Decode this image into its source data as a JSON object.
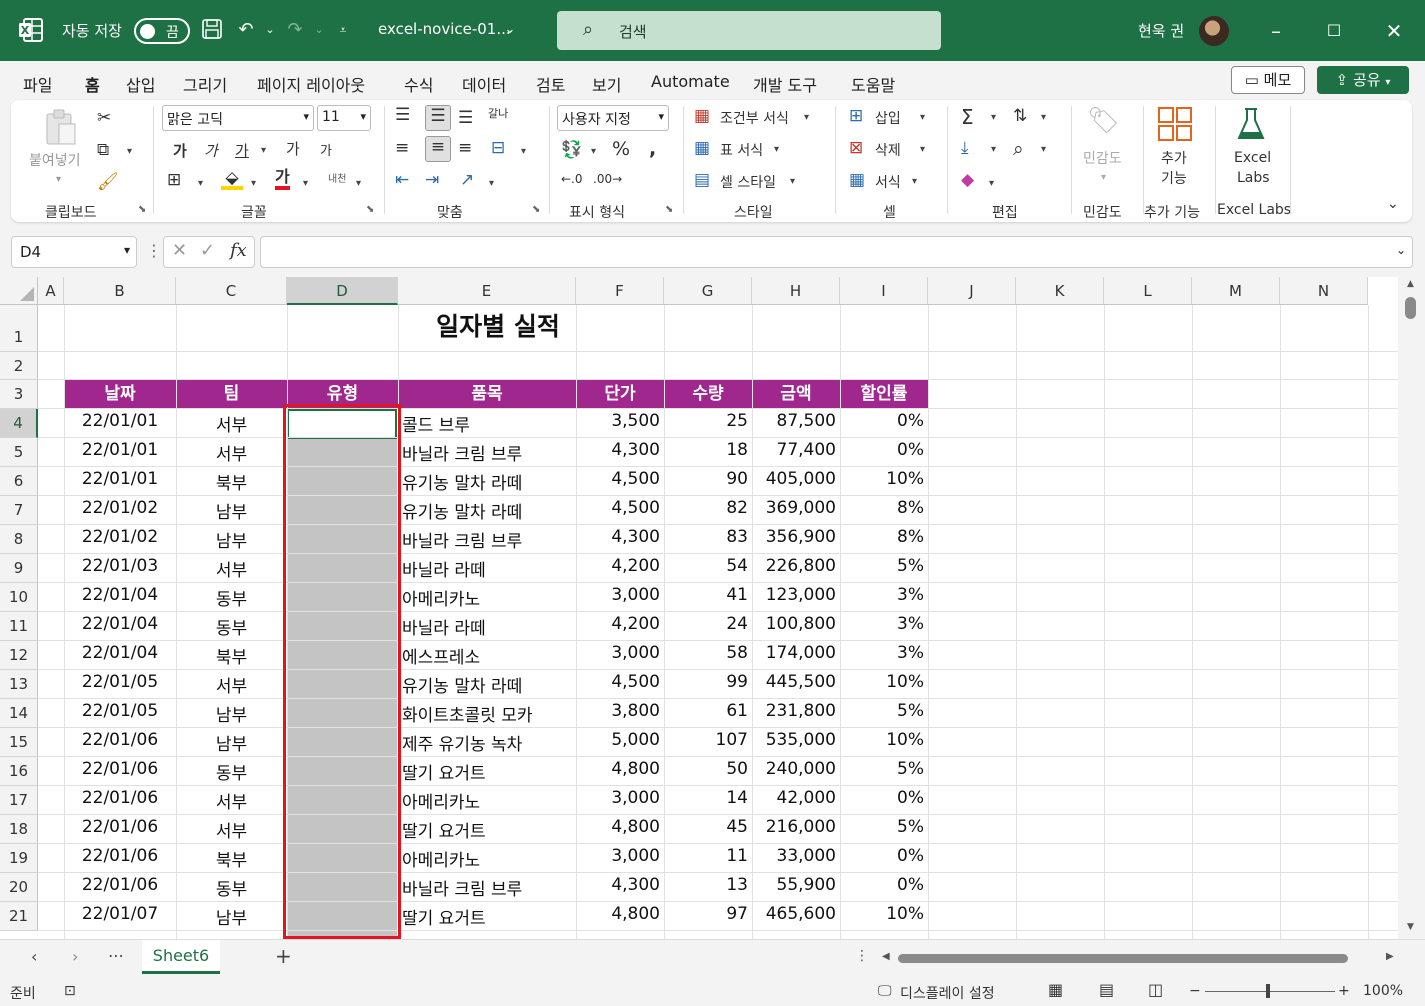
{
  "titlebar": {
    "autosave_label": "자동 저장",
    "autosave_state": "끔",
    "filename": "excel-novice-01...",
    "search_placeholder": "검색",
    "user_name": "현욱 권"
  },
  "menu": {
    "items": [
      "파일",
      "홈",
      "삽입",
      "그리기",
      "페이지 레이아웃",
      "수식",
      "데이터",
      "검토",
      "보기",
      "Automate",
      "개발 도구",
      "도움말"
    ],
    "active": "홈",
    "memo_label": "메모",
    "share_label": "공유"
  },
  "ribbon": {
    "clipboard": {
      "paste_label": "붙여넣기",
      "group_label": "클립보드"
    },
    "font": {
      "font_name": "맑은 고딕",
      "font_size": "11",
      "group_label": "글꼴",
      "bold": "가",
      "italic": "가",
      "underline": "가",
      "grow": "가",
      "shrink": "가",
      "phonetic": "내천",
      "font_color_glyph": "가"
    },
    "alignment": {
      "group_label": "맞춤",
      "wrap_glyph": "갈나"
    },
    "number": {
      "format": "사용자 지정",
      "group_label": "표시 형식"
    },
    "styles": {
      "conditional": "조건부 서식",
      "table": "표 서식",
      "cell": "셀 스타일",
      "group_label": "스타일"
    },
    "cells": {
      "insert": "삽입",
      "delete": "삭제",
      "format": "서식",
      "group_label": "셀"
    },
    "editing": {
      "group_label": "편집"
    },
    "sensitivity": {
      "label": "민감도",
      "group_label": "민감도"
    },
    "addins": {
      "label_line1": "추가",
      "label_line2": "기능",
      "group_label": "추가 기능"
    },
    "excel_labs": {
      "label_line1": "Excel",
      "label_line2": "Labs",
      "group_label": "Excel Labs"
    }
  },
  "formula_bar": {
    "name_box": "D4",
    "fx": "fx",
    "formula": ""
  },
  "sheet": {
    "columns": [
      "A",
      "B",
      "C",
      "D",
      "E",
      "F",
      "G",
      "H",
      "I",
      "J",
      "K",
      "L",
      "M",
      "N"
    ],
    "selected_column": "D",
    "rows": [
      "1",
      "2",
      "3",
      "4",
      "5",
      "6",
      "7",
      "8",
      "9",
      "10",
      "11",
      "12",
      "13",
      "14",
      "15",
      "16",
      "17",
      "18",
      "19",
      "20",
      "21"
    ],
    "title": "일자별 실적",
    "headers": [
      "날짜",
      "팀",
      "유형",
      "품목",
      "단가",
      "수량",
      "금액",
      "할인률"
    ],
    "data": [
      [
        "22/01/01",
        "서부",
        "",
        "콜드 브루",
        "3,500",
        "25",
        "87,500",
        "0%"
      ],
      [
        "22/01/01",
        "서부",
        "",
        "바닐라 크림 브루",
        "4,300",
        "18",
        "77,400",
        "0%"
      ],
      [
        "22/01/01",
        "북부",
        "",
        "유기농 말차 라떼",
        "4,500",
        "90",
        "405,000",
        "10%"
      ],
      [
        "22/01/02",
        "남부",
        "",
        "유기농 말차 라떼",
        "4,500",
        "82",
        "369,000",
        "8%"
      ],
      [
        "22/01/02",
        "남부",
        "",
        "바닐라 크림 브루",
        "4,300",
        "83",
        "356,900",
        "8%"
      ],
      [
        "22/01/03",
        "서부",
        "",
        "바닐라 라떼",
        "4,200",
        "54",
        "226,800",
        "5%"
      ],
      [
        "22/01/04",
        "동부",
        "",
        "아메리카노",
        "3,000",
        "41",
        "123,000",
        "3%"
      ],
      [
        "22/01/04",
        "동부",
        "",
        "바닐라 라떼",
        "4,200",
        "24",
        "100,800",
        "3%"
      ],
      [
        "22/01/04",
        "북부",
        "",
        "에스프레소",
        "3,000",
        "58",
        "174,000",
        "3%"
      ],
      [
        "22/01/05",
        "서부",
        "",
        "유기농 말차 라떼",
        "4,500",
        "99",
        "445,500",
        "10%"
      ],
      [
        "22/01/05",
        "남부",
        "",
        "화이트초콜릿 모카",
        "3,800",
        "61",
        "231,800",
        "5%"
      ],
      [
        "22/01/06",
        "남부",
        "",
        "제주 유기농 녹차",
        "5,000",
        "107",
        "535,000",
        "10%"
      ],
      [
        "22/01/06",
        "동부",
        "",
        "딸기 요거트",
        "4,800",
        "50",
        "240,000",
        "5%"
      ],
      [
        "22/01/06",
        "서부",
        "",
        "아메리카노",
        "3,000",
        "14",
        "42,000",
        "0%"
      ],
      [
        "22/01/06",
        "서부",
        "",
        "딸기 요거트",
        "4,800",
        "45",
        "216,000",
        "5%"
      ],
      [
        "22/01/06",
        "북부",
        "",
        "아메리카노",
        "3,000",
        "11",
        "33,000",
        "0%"
      ],
      [
        "22/01/06",
        "동부",
        "",
        "바닐라 크림 브루",
        "4,300",
        "13",
        "55,900",
        "0%"
      ],
      [
        "22/01/07",
        "남부",
        "",
        "딸기 요거트",
        "4,800",
        "97",
        "465,600",
        "10%"
      ]
    ],
    "tab_name": "Sheet6"
  },
  "status": {
    "ready": "준비",
    "display_settings": "디스플레이 설정",
    "zoom": "100%",
    "zoom_minus": "−",
    "zoom_plus": "+"
  },
  "colors": {
    "accent": "#1e7145",
    "table_header": "#a0278e",
    "highlight_border": "#e3131f",
    "gray_fill": "#c4c4c4"
  }
}
